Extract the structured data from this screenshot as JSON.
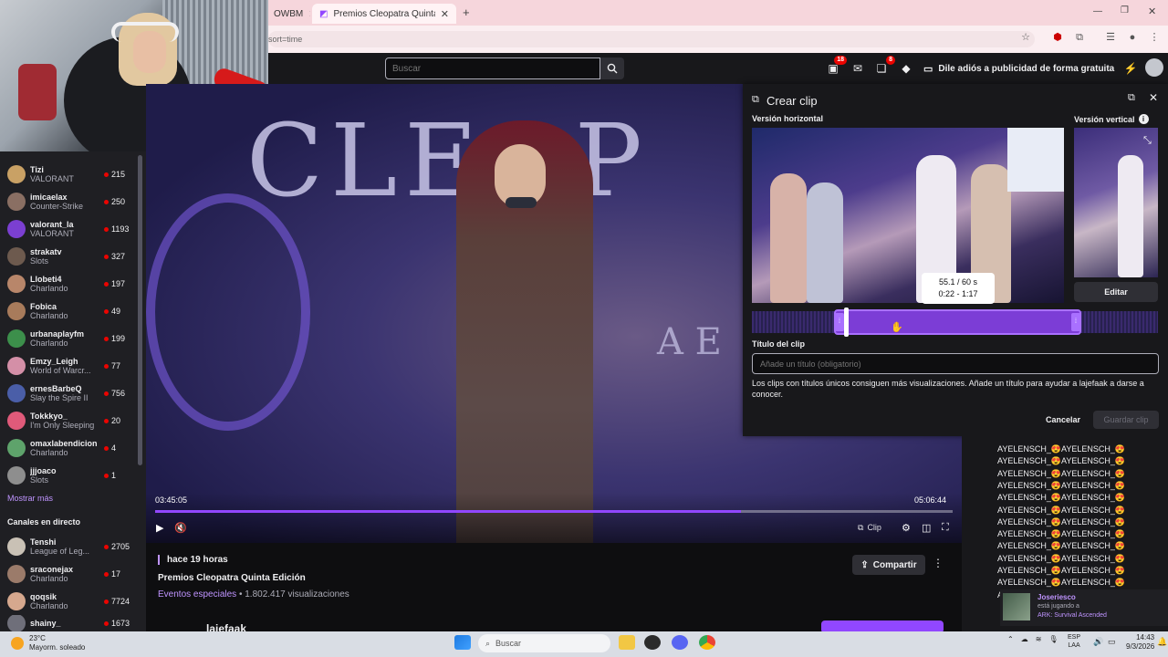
{
  "browser": {
    "tabs": [
      {
        "label": "OWBM",
        "active": false
      },
      {
        "label": "Premios Cleopatra Quinta E",
        "active": true
      }
    ],
    "url_fragment": "sort=time"
  },
  "twitch_nav": {
    "search_placeholder": "Buscar",
    "badges": {
      "notifications_a": "18",
      "notifications_b": "8"
    },
    "ad_free_label": "Dile adiós a publicidad de forma gratuita"
  },
  "sidebar": {
    "followed": [
      {
        "name": "Tizi",
        "game": "VALORANT",
        "viewers": "215",
        "avatar_color": "#c9a165"
      },
      {
        "name": "imicaelax",
        "game": "Counter-Strike",
        "viewers": "250",
        "avatar_color": "#8a6f63"
      },
      {
        "name": "valorant_la",
        "game": "VALORANT",
        "viewers": "1193",
        "avatar_color": "#7b3fd1"
      },
      {
        "name": "strakatv",
        "game": "Slots",
        "viewers": "327",
        "avatar_color": "#6d5a4e"
      },
      {
        "name": "Llobeti4",
        "game": "Charlando",
        "viewers": "197",
        "avatar_color": "#b8866a"
      },
      {
        "name": "Fobica",
        "game": "Charlando",
        "viewers": "49",
        "avatar_color": "#a87b5b"
      },
      {
        "name": "urbanaplayfm",
        "game": "Charlando",
        "viewers": "199",
        "avatar_color": "#3c8f4b"
      },
      {
        "name": "Emzy_Leigh",
        "game": "World of Warcr...",
        "viewers": "77",
        "avatar_color": "#d48fa7"
      },
      {
        "name": "ernesBarbeQ",
        "game": "Slay the Spire II",
        "viewers": "756",
        "avatar_color": "#4a5ea8"
      },
      {
        "name": "Tokkkyo_",
        "game": "I'm Only Sleeping",
        "viewers": "20",
        "avatar_color": "#e05a7a"
      },
      {
        "name": "omaxlabendicion",
        "game": "Charlando",
        "viewers": "4",
        "avatar_color": "#5ea36b"
      },
      {
        "name": "jjjoaco",
        "game": "Slots",
        "viewers": "1",
        "avatar_color": "#8e8e8e"
      }
    ],
    "show_more": "Mostrar más",
    "live_heading": "Canales en directo",
    "live": [
      {
        "name": "Tenshi",
        "game": "League of Leg...",
        "viewers": "2705",
        "avatar_color": "#c9c1b5"
      },
      {
        "name": "sraconejax",
        "game": "Charlando",
        "viewers": "17",
        "avatar_color": "#9b7b6a"
      },
      {
        "name": "qoqsik",
        "game": "Charlando",
        "viewers": "7724",
        "avatar_color": "#d6a88e"
      },
      {
        "name": "shainy_",
        "game": "",
        "viewers": "1673",
        "avatar_color": "#6f6f7a"
      }
    ]
  },
  "player": {
    "current_time": "03:45:05",
    "total_time": "05:06:44",
    "progress": 0.735,
    "clip_label": "Clip"
  },
  "video_info": {
    "when": "hace 19 horas",
    "title": "Premios Cleopatra Quinta Edición",
    "category": "Eventos especiales",
    "views": " • 1.802.417 visualizaciones",
    "share_label": "Compartir",
    "channel_partial": "lajefaak"
  },
  "clip_panel": {
    "title": "Crear clip",
    "horizontal_label": "Versión horizontal",
    "vertical_label": "Versión vertical",
    "tooltip_duration": "55.1 / 60 s",
    "tooltip_range": "0:22 - 1:17",
    "edit_label": "Editar",
    "clip_title_label": "Título del clip",
    "clip_title_placeholder": "Añade un título (obligatorio)",
    "hint": "Los clips con títulos únicos consiguen más visualizaciones. Añade un título para ayudar a lajefaak a darse a conocer.",
    "cancel_label": "Cancelar",
    "save_label": "Guardar clip"
  },
  "chat": {
    "lines": [
      "AYELENSCH_😍AYELENSCH_😍",
      "AYELENSCH_😍AYELENSCH_😍",
      "AYELENSCH_😍AYELENSCH_😍",
      "AYELENSCH_😍AYELENSCH_😍",
      "AYELENSCH_😍AYELENSCH_😍",
      "AYELENSCH_😍AYELENSCH_😍",
      "AYELENSCH_😍AYELENSCH_😍",
      "AYELENSCH_😍AYELENSCH_😍",
      "AYELENSCH_😍AYELENSCH_😍",
      "AYELENSCH_😍AYELENSCH_😍",
      "AYELENSCH_😍AYELENSCH_😍",
      "AYELENSCH_😍AYELENSCH_😍",
      "AYELENSCH_😍AYELENSCH_😍"
    ],
    "notification": {
      "name": "Joseriesco",
      "sub": "está jugando a",
      "game": "ARK: Survival Ascended"
    }
  },
  "taskbar": {
    "weather_temp": "23°C",
    "weather_desc": "Mayorm. soleado",
    "search_label": "Buscar",
    "lang_top": "ESP",
    "lang_bottom": "LAA",
    "time": "14:43",
    "date": "9/3/2026"
  }
}
